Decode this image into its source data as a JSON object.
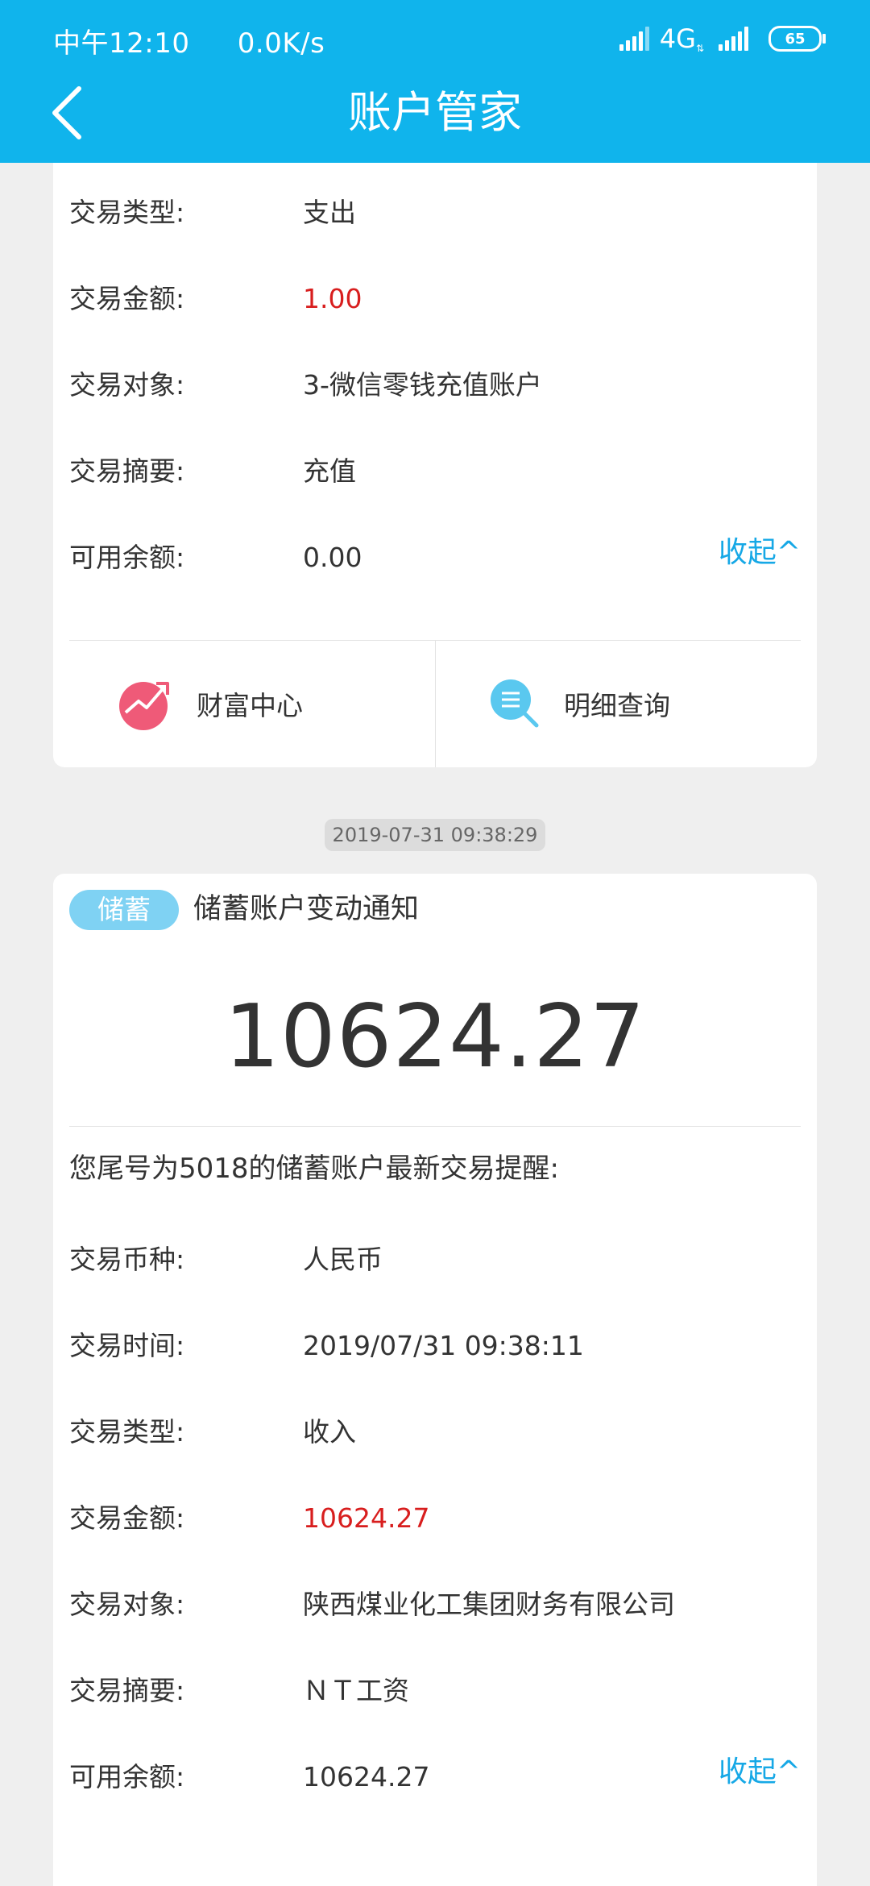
{
  "status_bar": {
    "time": "中午12:10",
    "speed": "0.0K/s",
    "network": "4G",
    "battery": "65"
  },
  "header": {
    "title": "账户管家"
  },
  "card1": {
    "rows": [
      {
        "label": "交易类型:",
        "value": "支出"
      },
      {
        "label": "交易金额:",
        "value": "1.00"
      },
      {
        "label": "交易对象:",
        "value": "3-微信零钱充值账户"
      },
      {
        "label": "交易摘要:",
        "value": "充值"
      },
      {
        "label": "可用余额:",
        "value": "0.00"
      }
    ],
    "collapse_label": "收起^",
    "actions": [
      {
        "label": "财富中心",
        "icon": "wealth-trend-icon"
      },
      {
        "label": "明细查询",
        "icon": "detail-search-icon"
      }
    ]
  },
  "timestamp": "2019-07-31 09:38:29",
  "card2": {
    "tag": "储蓄",
    "title": "储蓄账户变动通知",
    "amount": "10624.27",
    "reminder": "您尾号为5018的储蓄账户最新交易提醒:",
    "rows": [
      {
        "label": "交易币种:",
        "value": "人民币"
      },
      {
        "label": "交易时间:",
        "value": "2019/07/31 09:38:11"
      },
      {
        "label": "交易类型:",
        "value": "收入"
      },
      {
        "label": "交易金额:",
        "value": "10624.27"
      },
      {
        "label": "交易对象:",
        "value": "陕西煤业化工集团财务有限公司"
      },
      {
        "label": "交易摘要:",
        "value": "ＮＴ工资"
      },
      {
        "label": "可用余额:",
        "value": "10624.27"
      }
    ],
    "collapse_label": "收起^"
  },
  "colors": {
    "header": "#10b4ec",
    "accent_link": "#16a8e6",
    "amount_red": "#d81e1e",
    "tag": "#7fd2f3",
    "wealth_icon": "#ef5a78",
    "search_icon": "#5ac8ef"
  }
}
